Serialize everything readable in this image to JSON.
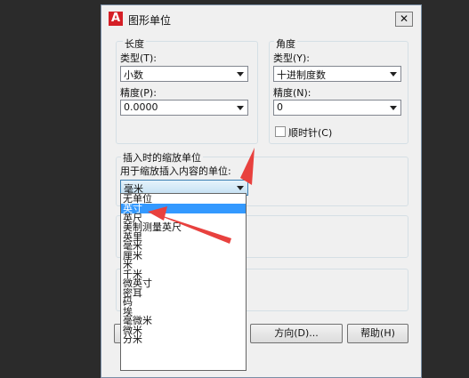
{
  "dialog": {
    "title": "图形单位",
    "close_glyph": "✕"
  },
  "length": {
    "group_label": "长度",
    "type_label": "类型(T):",
    "type_value": "小数",
    "precision_label": "精度(P):",
    "precision_value": "0.0000"
  },
  "angle": {
    "group_label": "角度",
    "type_label": "类型(Y):",
    "type_value": "十进制度数",
    "precision_label": "精度(N):",
    "precision_value": "0",
    "clockwise_label": "顺时针(C)"
  },
  "insertion": {
    "group_label": "插入时的缩放单位",
    "units_label": "用于缩放插入内容的单位:",
    "units_value": "毫米"
  },
  "units_dropdown": {
    "options": [
      "无单位",
      "英寸",
      "英尺",
      "美制测量英尺",
      "英里",
      "毫米",
      "厘米",
      "米",
      "千米",
      "微英寸",
      "密耳",
      "码",
      "埃",
      "毫微米",
      "微米",
      "分米"
    ],
    "selected_index": 1
  },
  "buttons": {
    "direction": "方向(D)...",
    "help": "帮助(H)"
  },
  "colors": {
    "highlight": "#3399ff",
    "arrow": "#e8413e"
  }
}
